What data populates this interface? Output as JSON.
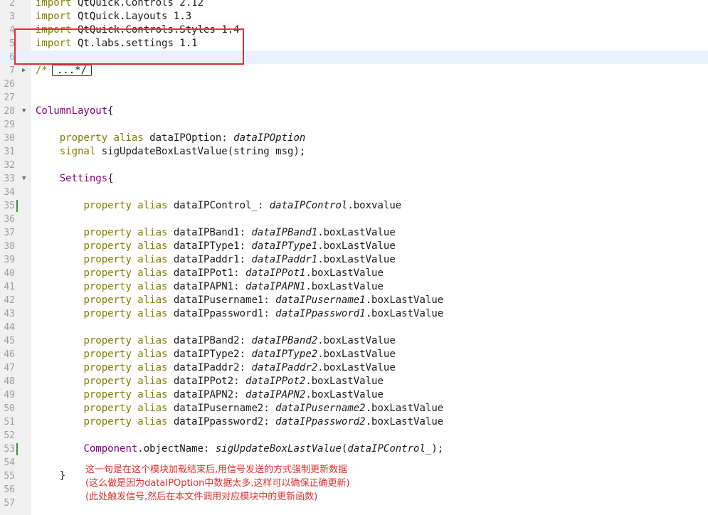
{
  "editor": {
    "lines": [
      {
        "num": "2",
        "tokens": [
          {
            "t": "import",
            "c": "kw"
          },
          {
            "t": " QtQuick.Controls 2.12"
          }
        ]
      },
      {
        "num": "3",
        "tokens": [
          {
            "t": "import",
            "c": "kw"
          },
          {
            "t": " QtQuick.Layouts 1.3"
          }
        ]
      },
      {
        "num": "4",
        "tokens": [
          {
            "t": "import",
            "c": "kw"
          },
          {
            "t": " QtQuick.Controls.Styles 1.4"
          }
        ]
      },
      {
        "num": "5",
        "tokens": [
          {
            "t": "import",
            "c": "kw"
          },
          {
            "t": " Qt.labs.settings 1.1"
          }
        ]
      },
      {
        "num": "6",
        "current": true,
        "tokens": []
      },
      {
        "num": "7",
        "fold": "right",
        "tokens": [
          {
            "t": "/*",
            "c": "kw"
          }
        ],
        "collapsed": "...*/"
      },
      {
        "num": "26",
        "tokens": []
      },
      {
        "num": "27",
        "tokens": []
      },
      {
        "num": "28",
        "fold": "down",
        "tokens": [
          {
            "t": "ColumnLayout",
            "c": "ty"
          },
          {
            "t": "{"
          }
        ]
      },
      {
        "num": "29",
        "tokens": []
      },
      {
        "num": "30",
        "tokens": [
          {
            "t": "    "
          },
          {
            "t": "property alias",
            "c": "kw"
          },
          {
            "t": " dataIPOption: "
          },
          {
            "t": "dataIPOption",
            "c": "it"
          }
        ]
      },
      {
        "num": "31",
        "tokens": [
          {
            "t": "    "
          },
          {
            "t": "signal",
            "c": "kw"
          },
          {
            "t": " sigUpdateBoxLastValue(string msg);"
          }
        ]
      },
      {
        "num": "32",
        "tokens": []
      },
      {
        "num": "33",
        "fold": "down",
        "tokens": [
          {
            "t": "    "
          },
          {
            "t": "Settings",
            "c": "ty"
          },
          {
            "t": "{"
          }
        ]
      },
      {
        "num": "34",
        "tokens": []
      },
      {
        "num": "35",
        "mark": true,
        "tokens": [
          {
            "t": "        "
          },
          {
            "t": "property alias",
            "c": "kw"
          },
          {
            "t": " dataIPControl_: "
          },
          {
            "t": "dataIPControl",
            "c": "it"
          },
          {
            "t": ".boxvalue"
          }
        ]
      },
      {
        "num": "36",
        "tokens": []
      },
      {
        "num": "37",
        "tokens": [
          {
            "t": "        "
          },
          {
            "t": "property alias",
            "c": "kw"
          },
          {
            "t": " dataIPBand1: "
          },
          {
            "t": "dataIPBand1",
            "c": "it"
          },
          {
            "t": ".boxLastValue"
          }
        ]
      },
      {
        "num": "38",
        "tokens": [
          {
            "t": "        "
          },
          {
            "t": "property alias",
            "c": "kw"
          },
          {
            "t": " dataIPType1: "
          },
          {
            "t": "dataIPType1",
            "c": "it"
          },
          {
            "t": ".boxLastValue"
          }
        ]
      },
      {
        "num": "39",
        "tokens": [
          {
            "t": "        "
          },
          {
            "t": "property alias",
            "c": "kw"
          },
          {
            "t": " dataIPaddr1: "
          },
          {
            "t": "dataIPaddr1",
            "c": "it"
          },
          {
            "t": ".boxLastValue"
          }
        ]
      },
      {
        "num": "40",
        "tokens": [
          {
            "t": "        "
          },
          {
            "t": "property alias",
            "c": "kw"
          },
          {
            "t": " dataIPPot1: "
          },
          {
            "t": "dataIPPot1",
            "c": "it"
          },
          {
            "t": ".boxLastValue"
          }
        ]
      },
      {
        "num": "41",
        "tokens": [
          {
            "t": "        "
          },
          {
            "t": "property alias",
            "c": "kw"
          },
          {
            "t": " dataIPAPN1: "
          },
          {
            "t": "dataIPAPN1",
            "c": "it"
          },
          {
            "t": ".boxLastValue"
          }
        ]
      },
      {
        "num": "42",
        "tokens": [
          {
            "t": "        "
          },
          {
            "t": "property alias",
            "c": "kw"
          },
          {
            "t": " dataIPusername1: "
          },
          {
            "t": "dataIPusername1",
            "c": "it"
          },
          {
            "t": ".boxLastValue"
          }
        ]
      },
      {
        "num": "43",
        "tokens": [
          {
            "t": "        "
          },
          {
            "t": "property alias",
            "c": "kw"
          },
          {
            "t": " dataIPpassword1: "
          },
          {
            "t": "dataIPpassword1",
            "c": "it"
          },
          {
            "t": ".boxLastValue"
          }
        ]
      },
      {
        "num": "44",
        "tokens": []
      },
      {
        "num": "45",
        "tokens": [
          {
            "t": "        "
          },
          {
            "t": "property alias",
            "c": "kw"
          },
          {
            "t": " dataIPBand2: "
          },
          {
            "t": "dataIPBand2",
            "c": "it"
          },
          {
            "t": ".boxLastValue"
          }
        ]
      },
      {
        "num": "46",
        "tokens": [
          {
            "t": "        "
          },
          {
            "t": "property alias",
            "c": "kw"
          },
          {
            "t": " dataIPType2: "
          },
          {
            "t": "dataIPType2",
            "c": "it"
          },
          {
            "t": ".boxLastValue"
          }
        ]
      },
      {
        "num": "47",
        "tokens": [
          {
            "t": "        "
          },
          {
            "t": "property alias",
            "c": "kw"
          },
          {
            "t": " dataIPaddr2: "
          },
          {
            "t": "dataIPaddr2",
            "c": "it"
          },
          {
            "t": ".boxLastValue"
          }
        ]
      },
      {
        "num": "48",
        "tokens": [
          {
            "t": "        "
          },
          {
            "t": "property alias",
            "c": "kw"
          },
          {
            "t": " dataIPPot2: "
          },
          {
            "t": "dataIPPot2",
            "c": "it"
          },
          {
            "t": ".boxLastValue"
          }
        ]
      },
      {
        "num": "49",
        "tokens": [
          {
            "t": "        "
          },
          {
            "t": "property alias",
            "c": "kw"
          },
          {
            "t": " dataIPAPN2: "
          },
          {
            "t": "dataIPAPN2",
            "c": "it"
          },
          {
            "t": ".boxLastValue"
          }
        ]
      },
      {
        "num": "50",
        "tokens": [
          {
            "t": "        "
          },
          {
            "t": "property alias",
            "c": "kw"
          },
          {
            "t": " dataIPusername2: "
          },
          {
            "t": "dataIPusername2",
            "c": "it"
          },
          {
            "t": ".boxLastValue"
          }
        ]
      },
      {
        "num": "51",
        "tokens": [
          {
            "t": "        "
          },
          {
            "t": "property alias",
            "c": "kw"
          },
          {
            "t": " dataIPpassword2: "
          },
          {
            "t": "dataIPpassword2",
            "c": "it"
          },
          {
            "t": ".boxLastValue"
          }
        ]
      },
      {
        "num": "52",
        "tokens": []
      },
      {
        "num": "53",
        "mark": true,
        "tokens": [
          {
            "t": "        "
          },
          {
            "t": "Component",
            "c": "ty"
          },
          {
            "t": ".objectName: "
          },
          {
            "t": "sigUpdateBoxLastValue",
            "c": "it"
          },
          {
            "t": "("
          },
          {
            "t": "dataIPControl_",
            "c": "it"
          },
          {
            "t": ");"
          }
        ]
      },
      {
        "num": "54",
        "tokens": []
      },
      {
        "num": "55",
        "tokens": [
          {
            "t": "    }"
          }
        ]
      },
      {
        "num": "56",
        "tokens": []
      },
      {
        "num": "57",
        "tokens": []
      }
    ]
  },
  "annotation": {
    "lines": [
      "这一句是在这个模块加载结束后,用信号发送的方式强制更新数据",
      "(这么做是因为dataIPOption中数据太多,这样可以确保正确更新)",
      "(此处触发信号,然后在本文件调用对应模块中的更新函数)"
    ],
    "color": "#e03030"
  },
  "colors": {
    "keyword": "#808000",
    "type": "#800080",
    "gutter": "#f0f0f0",
    "current_line": "#e8f2fe",
    "change_marker": "#3c8f3c"
  }
}
